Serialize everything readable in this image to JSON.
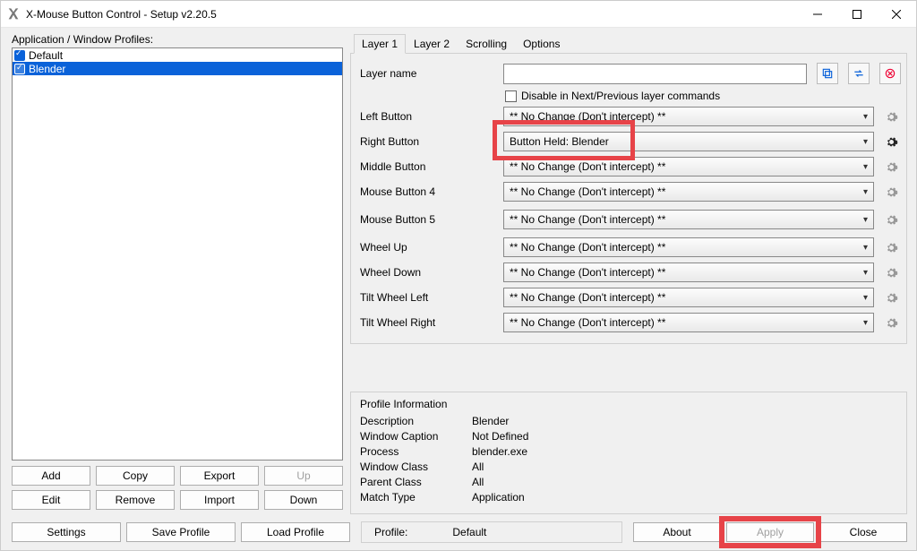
{
  "window": {
    "title": "X-Mouse Button Control - Setup v2.20.5"
  },
  "left": {
    "label": "Application / Window Profiles:",
    "profiles": [
      "Default",
      "Blender"
    ],
    "buttons": {
      "add": "Add",
      "copy": "Copy",
      "export": "Export",
      "up": "Up",
      "edit": "Edit",
      "remove": "Remove",
      "import": "Import",
      "down": "Down"
    }
  },
  "tabs": [
    "Layer 1",
    "Layer 2",
    "Scrolling",
    "Options"
  ],
  "layer": {
    "name_label": "Layer name",
    "name_value": "",
    "disable_label": "Disable in Next/Previous layer commands",
    "rows": [
      {
        "label": "Left Button",
        "value": "** No Change (Don't intercept) **",
        "gear_on": false,
        "hl": false
      },
      {
        "label": "Right Button",
        "value": "Button Held: Blender",
        "gear_on": true,
        "hl": true
      },
      {
        "label": "Middle Button",
        "value": "** No Change (Don't intercept) **",
        "gear_on": false,
        "hl": false
      },
      {
        "label": "Mouse Button 4",
        "value": "** No Change (Don't intercept) **",
        "gear_on": false,
        "hl": false
      },
      {
        "label": "Mouse Button 5",
        "value": "** No Change (Don't intercept) **",
        "gear_on": false,
        "hl": false
      },
      {
        "label": "Wheel Up",
        "value": "** No Change (Don't intercept) **",
        "gear_on": false,
        "hl": false
      },
      {
        "label": "Wheel Down",
        "value": "** No Change (Don't intercept) **",
        "gear_on": false,
        "hl": false
      },
      {
        "label": "Tilt Wheel Left",
        "value": "** No Change (Don't intercept) **",
        "gear_on": false,
        "hl": false
      },
      {
        "label": "Tilt Wheel Right",
        "value": "** No Change (Don't intercept) **",
        "gear_on": false,
        "hl": false
      }
    ]
  },
  "profileInfo": {
    "title": "Profile Information",
    "rows": [
      {
        "k": "Description",
        "v": "Blender"
      },
      {
        "k": "Window Caption",
        "v": "Not Defined"
      },
      {
        "k": "Process",
        "v": "blender.exe"
      },
      {
        "k": "Window Class",
        "v": "All"
      },
      {
        "k": "Parent Class",
        "v": "All"
      },
      {
        "k": "Match Type",
        "v": "Application"
      }
    ]
  },
  "bottom": {
    "settings": "Settings",
    "save": "Save Profile",
    "load": "Load Profile",
    "profileLabel": "Profile:",
    "profileValue": "Default",
    "about": "About",
    "apply": "Apply",
    "close": "Close"
  }
}
